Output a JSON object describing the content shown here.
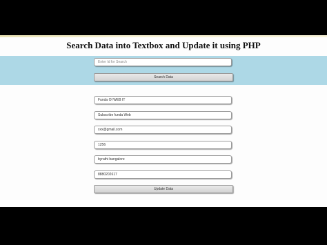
{
  "page": {
    "title": "Search Data into Textbox and Update it using PHP"
  },
  "search": {
    "placeholder": "Enter Id for Search",
    "button_label": "Search Data"
  },
  "record": {
    "fields": [
      {
        "value": "Funda Of WEB IT"
      },
      {
        "value": "Subscribe funda Web"
      },
      {
        "value": "xxx@gmail.com"
      },
      {
        "value": "1256"
      },
      {
        "value": "byrathi bangalore"
      },
      {
        "value": "8880202617"
      }
    ],
    "button_label": "Update Data"
  },
  "colors": {
    "search_band": "#add8e6",
    "page_background": "#fdfdfd",
    "outer_background": "#000000"
  }
}
